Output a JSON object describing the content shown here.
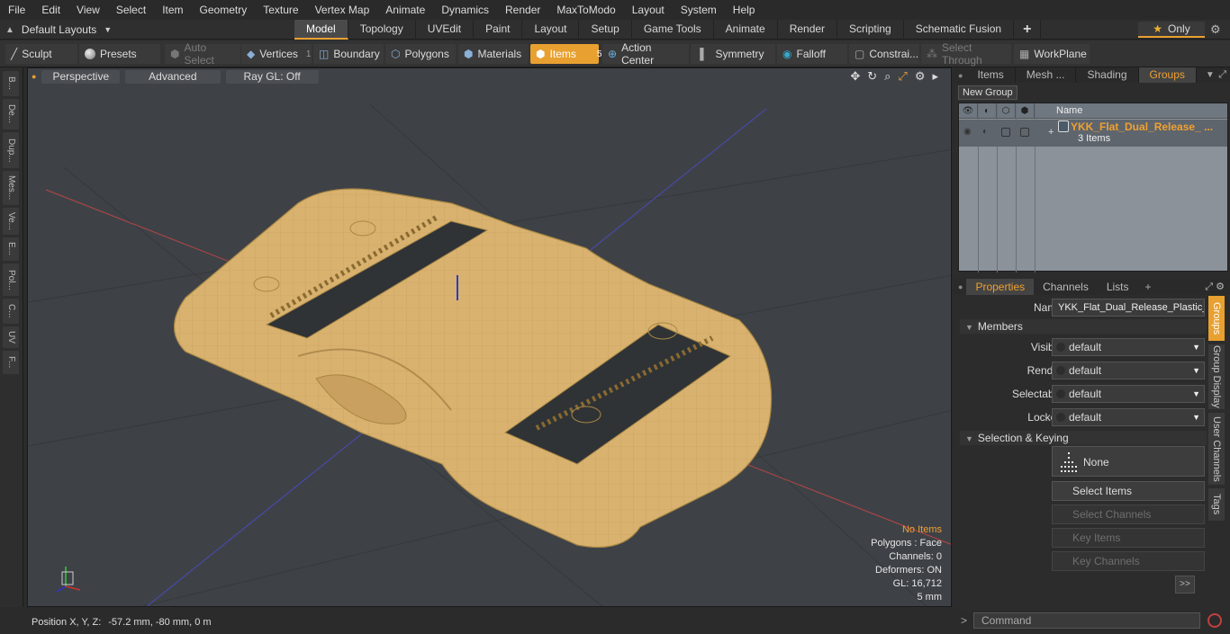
{
  "menu": [
    "File",
    "Edit",
    "View",
    "Select",
    "Item",
    "Geometry",
    "Texture",
    "Vertex Map",
    "Animate",
    "Dynamics",
    "Render",
    "MaxToModo",
    "Layout",
    "System",
    "Help"
  ],
  "layout": {
    "selector": "Default Layouts",
    "tabs": [
      "Model",
      "Topology",
      "UVEdit",
      "Paint",
      "Layout",
      "Setup",
      "Game Tools",
      "Animate",
      "Render",
      "Scripting",
      "Schematic Fusion"
    ],
    "active_tab": "Model",
    "only_label": "Only"
  },
  "toolbar": {
    "sculpt": "Sculpt",
    "presets": "Presets",
    "auto_select": "Auto Select",
    "vertices": "Vertices",
    "vertices_count": "1",
    "boundary": "Boundary",
    "polygons": "Polygons",
    "materials": "Materials",
    "items": "Items",
    "items_count": "5",
    "action_center": "Action Center",
    "symmetry": "Symmetry",
    "falloff": "Falloff",
    "constraints": "Constrai...",
    "select_through": "Select Through",
    "workplane": "WorkPlane"
  },
  "left_tabs": [
    "B...",
    "De...",
    "Dup...",
    "Mes...",
    "Ve...",
    "E...",
    "Pol...",
    "C...",
    "UV",
    "F..."
  ],
  "viewport": {
    "view": "Perspective",
    "shading": "Advanced",
    "raygl": "Ray GL: Off",
    "info": {
      "selection": "No Items",
      "polygons": "Polygons : Face",
      "channels": "Channels: 0",
      "deformers": "Deformers: ON",
      "gl": "GL: 16,712",
      "scale": "5 mm"
    }
  },
  "status": {
    "label": "Position X, Y, Z:",
    "value": "-57.2 mm, -80 mm, 0 m"
  },
  "right_panel": {
    "tabs": [
      "Items",
      "Mesh ...",
      "Shading",
      "Groups"
    ],
    "active_tab": "Groups",
    "new_group": "New Group",
    "list_header": "Name",
    "group": {
      "name": "YKK_Flat_Dual_Release_ ...",
      "count": "3 Items"
    }
  },
  "properties": {
    "tabs": [
      "Properties",
      "Channels",
      "Lists"
    ],
    "active_tab": "Properties",
    "name_label": "Name",
    "name_value": "YKK_Flat_Dual_Release_Plastic_B",
    "members_section": "Members",
    "fields": [
      {
        "label": "Visible",
        "value": "default"
      },
      {
        "label": "Render",
        "value": "default"
      },
      {
        "label": "Selectable",
        "value": "default"
      },
      {
        "label": "Locked",
        "value": "default"
      }
    ],
    "selection_section": "Selection & Keying",
    "none_label": "None",
    "buttons": {
      "select_items": "Select Items",
      "select_channels": "Select Channels",
      "key_items": "Key Items",
      "key_channels": "Key Channels",
      "more": ">>"
    }
  },
  "right_vtabs": [
    "Groups",
    "Group Display",
    "User Channels",
    "Tags"
  ],
  "command": {
    "placeholder": "Command"
  },
  "colors": {
    "accent": "#e8a030",
    "model": "#d9b26f",
    "viewport_bg": "#3e4247"
  }
}
